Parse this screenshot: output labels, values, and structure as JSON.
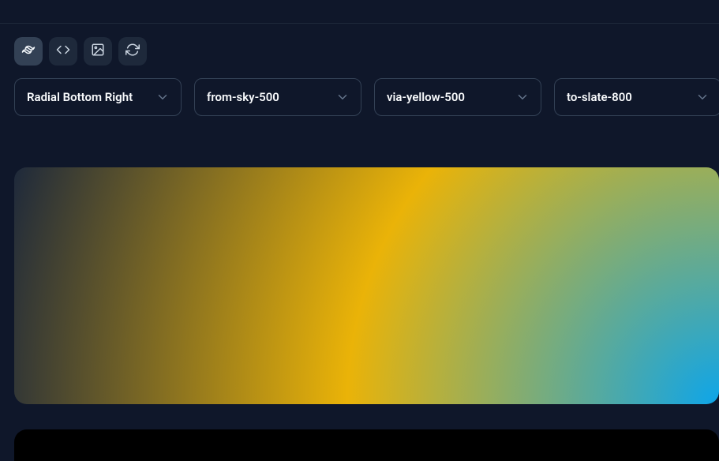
{
  "tabs": {
    "tailwind": "tailwind",
    "code": "code",
    "image": "image",
    "shuffle": "shuffle"
  },
  "selects": {
    "direction": {
      "label": "Radial Bottom Right"
    },
    "from": {
      "label": "from-sky-500"
    },
    "via": {
      "label": "via-yellow-500"
    },
    "to": {
      "label": "to-slate-800"
    }
  },
  "gradient": {
    "type": "radial",
    "position": "100% 100%",
    "from_color": "#0ea5e9",
    "via_color": "#eab308",
    "to_color": "#1e293b",
    "from_class": "from-sky-500",
    "via_class": "via-yellow-500",
    "to_class": "to-slate-800",
    "direction_class": "bg-gradient-radial"
  }
}
